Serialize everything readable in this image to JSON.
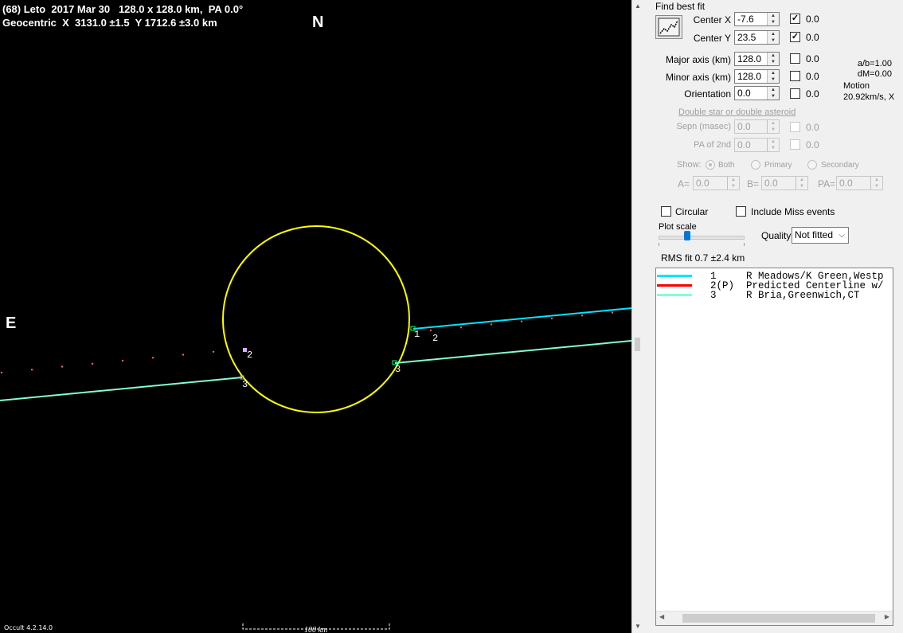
{
  "plot": {
    "title_line1": "(68) Leto  2017 Mar 30   128.0 x 128.0 km,  PA 0.0°",
    "title_line2": "Geocentric  X  3131.0 ±1.5  Y 1712.6 ±3.0 km",
    "north_label": "N",
    "east_label": "E",
    "version": "Occult 4.2.14.0",
    "scale_label": "100 km",
    "chord_labels": {
      "c1": "1",
      "c2a": "2",
      "c2b": "2",
      "c3a": "3",
      "c3b": "3"
    },
    "colors": {
      "background": "#000000",
      "ellipse": "#ffff00",
      "chord1": "#00e5ff",
      "chord3": "#7fffd4",
      "predicted_dots": "#ff6060"
    }
  },
  "panel": {
    "find_best_fit_label": "Find best fit",
    "center_x": {
      "label": "Center X",
      "value": "-7.6",
      "checked": true,
      "check_value": "0.0"
    },
    "center_y": {
      "label": "Center Y",
      "value": "23.5",
      "checked": true,
      "check_value": "0.0"
    },
    "major_axis": {
      "label": "Major axis (km)",
      "value": "128.0",
      "checked": false,
      "check_value": "0.0"
    },
    "minor_axis": {
      "label": "Minor axis (km)",
      "value": "128.0",
      "checked": false,
      "check_value": "0.0"
    },
    "orientation": {
      "label": "Orientation",
      "value": "0.0",
      "checked": false,
      "check_value": "0.0"
    },
    "ratio_text": "a/b=1.00",
    "dm_text": "dM=0.00",
    "motion_label": "Motion",
    "motion_value": "20.92km/s, X",
    "double_star_link": "Double star  or  double asteroid",
    "sepn": {
      "label": "Sepn (masec)",
      "value": "0.0",
      "check_value": "0.0"
    },
    "pa2nd": {
      "label": "PA of 2nd",
      "value": "0.0",
      "check_value": "0.0"
    },
    "show": {
      "label": "Show:",
      "options": [
        "Both",
        "Primary",
        "Secondary"
      ],
      "selected": "Both"
    },
    "a_field": {
      "label": "A=",
      "value": "0.0"
    },
    "b_field": {
      "label": "B=",
      "value": "0.0"
    },
    "pa_field": {
      "label": "PA=",
      "value": "0.0"
    },
    "circular_label": "Circular",
    "include_miss_label": "Include Miss events",
    "plot_scale_label": "Plot scale",
    "plot_scale_level": 0.3,
    "quality_label": "Quality",
    "quality_value": "Not fitted",
    "rms_fit": "RMS fit  0.7 ±2.4 km",
    "legend": [
      {
        "text": "1     R Meadows/K Green,Westp",
        "color": "#00e5ff"
      },
      {
        "text": "2(P)  Predicted Centerline w/",
        "color": "#ff0000"
      },
      {
        "text": "3     R Bria,Greenwich,CT",
        "color": "#7fffd4"
      }
    ]
  }
}
